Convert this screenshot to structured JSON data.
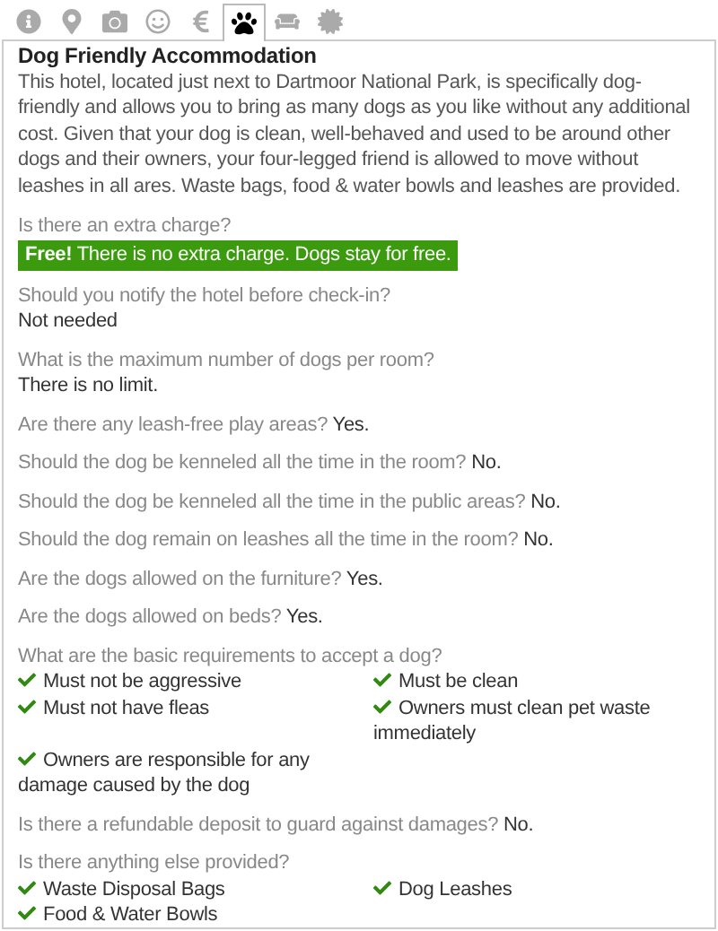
{
  "tabs": [
    {
      "kind": "info",
      "selected": false
    },
    {
      "kind": "location",
      "selected": false
    },
    {
      "kind": "camera",
      "selected": false
    },
    {
      "kind": "smile",
      "selected": false
    },
    {
      "kind": "euro",
      "selected": false
    },
    {
      "kind": "paw",
      "selected": true
    },
    {
      "kind": "sofa",
      "selected": false
    },
    {
      "kind": "award",
      "selected": false
    }
  ],
  "title": "Dog Friendly Accommodation",
  "intro": "This hotel, located just next to Dartmoor National Park, is specifically dog-friendly and allows you to bring as many dogs as you like without any additional cost. Given that your dog is clean, well-behaved and used to be around other dogs and their owners, your four-legged friend is allowed to move without leashes in all ares. Waste bags, food & water bowls and leashes are provided.",
  "questions": [
    {
      "kind": "highlight",
      "question": "Is there an extra charge?",
      "answer": "**Free!** There is no extra charge. Dogs stay for free."
    },
    {
      "kind": "block",
      "question": "Should you notify the hotel before check-in?",
      "answer": "Not needed"
    },
    {
      "kind": "block",
      "question": "What is the maximum number of dogs per room?",
      "answer": "There is no limit."
    },
    {
      "kind": "inline",
      "question": "Are there any leash-free play areas?",
      "answer": "Yes."
    },
    {
      "kind": "inline",
      "question": "Should the dog be kenneled all the time in the room?",
      "answer": "No."
    },
    {
      "kind": "inline",
      "question": "Should the dog be kenneled all the time in the public areas?",
      "answer": "No."
    },
    {
      "kind": "inline",
      "question": "Should the dog remain on leashes all the time in the room?",
      "answer": "No."
    },
    {
      "kind": "inline",
      "question": "Are the dogs allowed on the furniture?",
      "answer": "Yes."
    },
    {
      "kind": "inline",
      "question": "Are the dogs allowed on beds?",
      "answer": "Yes."
    },
    {
      "kind": "list",
      "question": "What are the basic requirements to accept a dog?",
      "items": [
        "Must not be aggressive",
        "Must be clean",
        "Must not have fleas",
        "Owners must clean pet waste immediately",
        "Owners are responsible for any damage caused by the dog"
      ]
    },
    {
      "kind": "inline",
      "question": "Is there a refundable deposit to guard against damages?",
      "answer": "No."
    },
    {
      "kind": "list",
      "question": "Is there anything else provided?",
      "items": [
        "Waste Disposal Bags",
        "Dog Leashes",
        "Food & Water Bowls"
      ]
    }
  ]
}
